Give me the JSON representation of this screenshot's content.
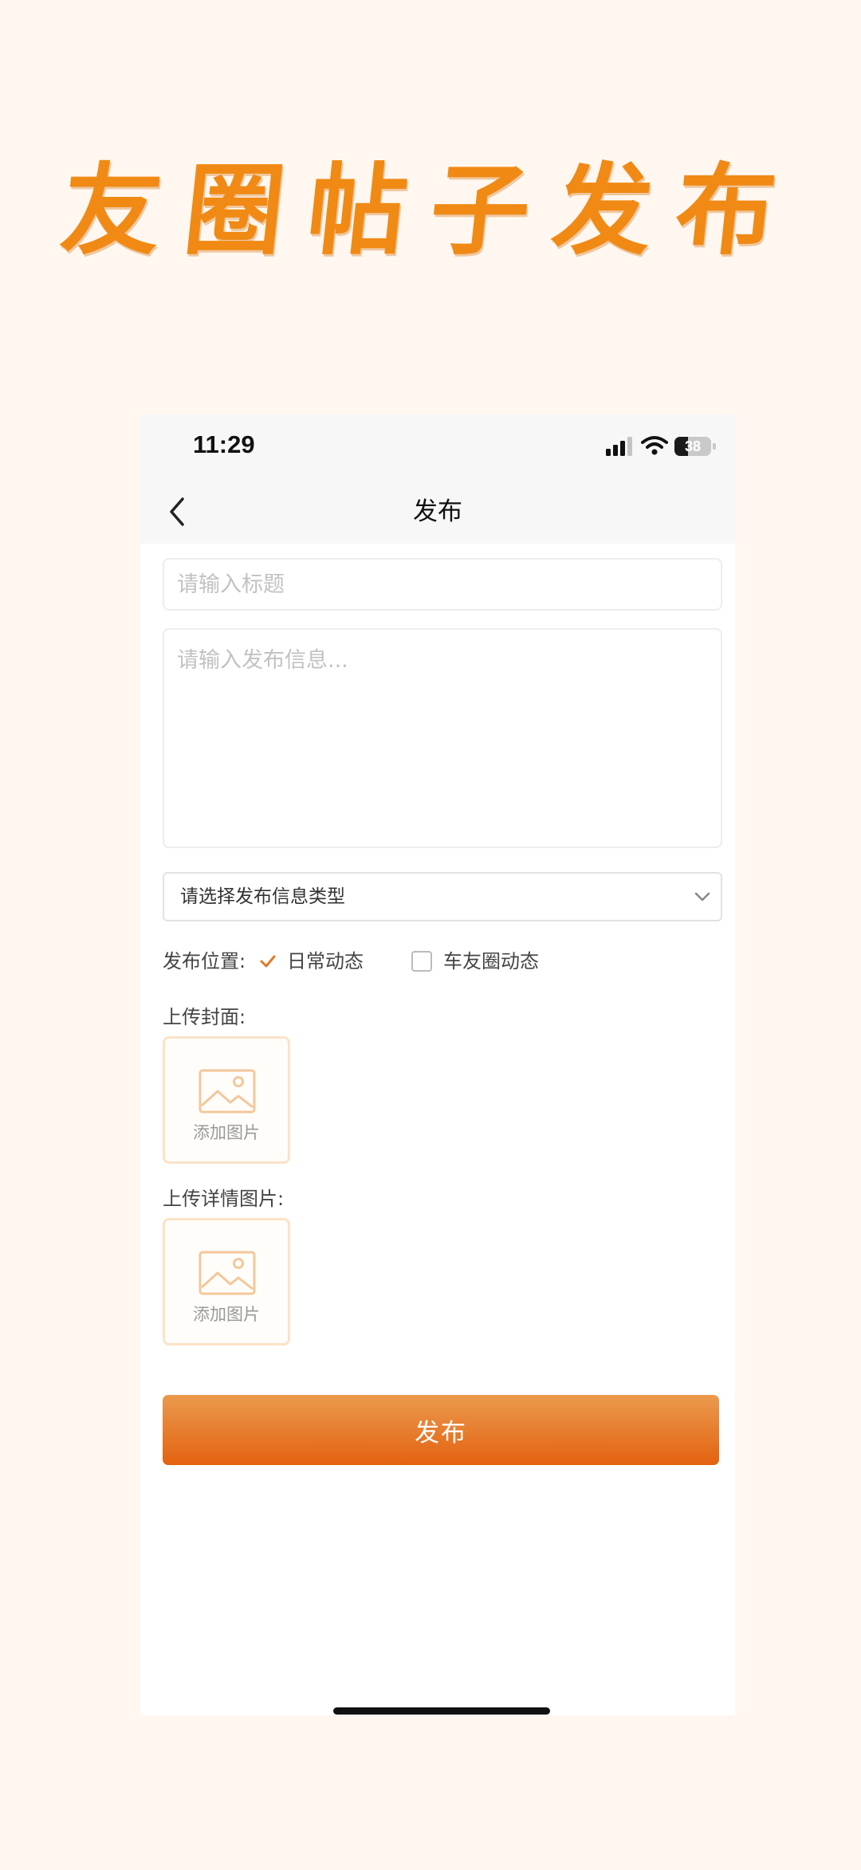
{
  "banner": {
    "title": "友圈帖子发布"
  },
  "status_bar": {
    "time": "11:29",
    "battery": "38",
    "battery_level_percent": 38,
    "signal_icon": "signal-bars-icon",
    "wifi_icon": "wifi-icon",
    "battery_icon": "battery-icon"
  },
  "nav": {
    "title": "发布",
    "back_icon": "chevron-left-icon"
  },
  "form": {
    "title_placeholder": "请输入标题",
    "content_placeholder": "请输入发布信息...",
    "type_select": {
      "selected": "请选择发布信息类型",
      "icon": "chevron-down-icon"
    },
    "location": {
      "label": "发布位置:",
      "options": [
        {
          "label": "日常动态",
          "checked": true
        },
        {
          "label": "车友圈动态",
          "checked": false
        }
      ]
    },
    "cover": {
      "label": "上传封面:",
      "add_label": "添加图片"
    },
    "detail_images": {
      "label": "上传详情图片:",
      "add_label": "添加图片"
    },
    "submit_label": "发布"
  },
  "colors": {
    "accent": "#e3620f",
    "accent_light": "#eb9a4f",
    "banner": "#f08a14",
    "page_background": "#fff7f0"
  }
}
